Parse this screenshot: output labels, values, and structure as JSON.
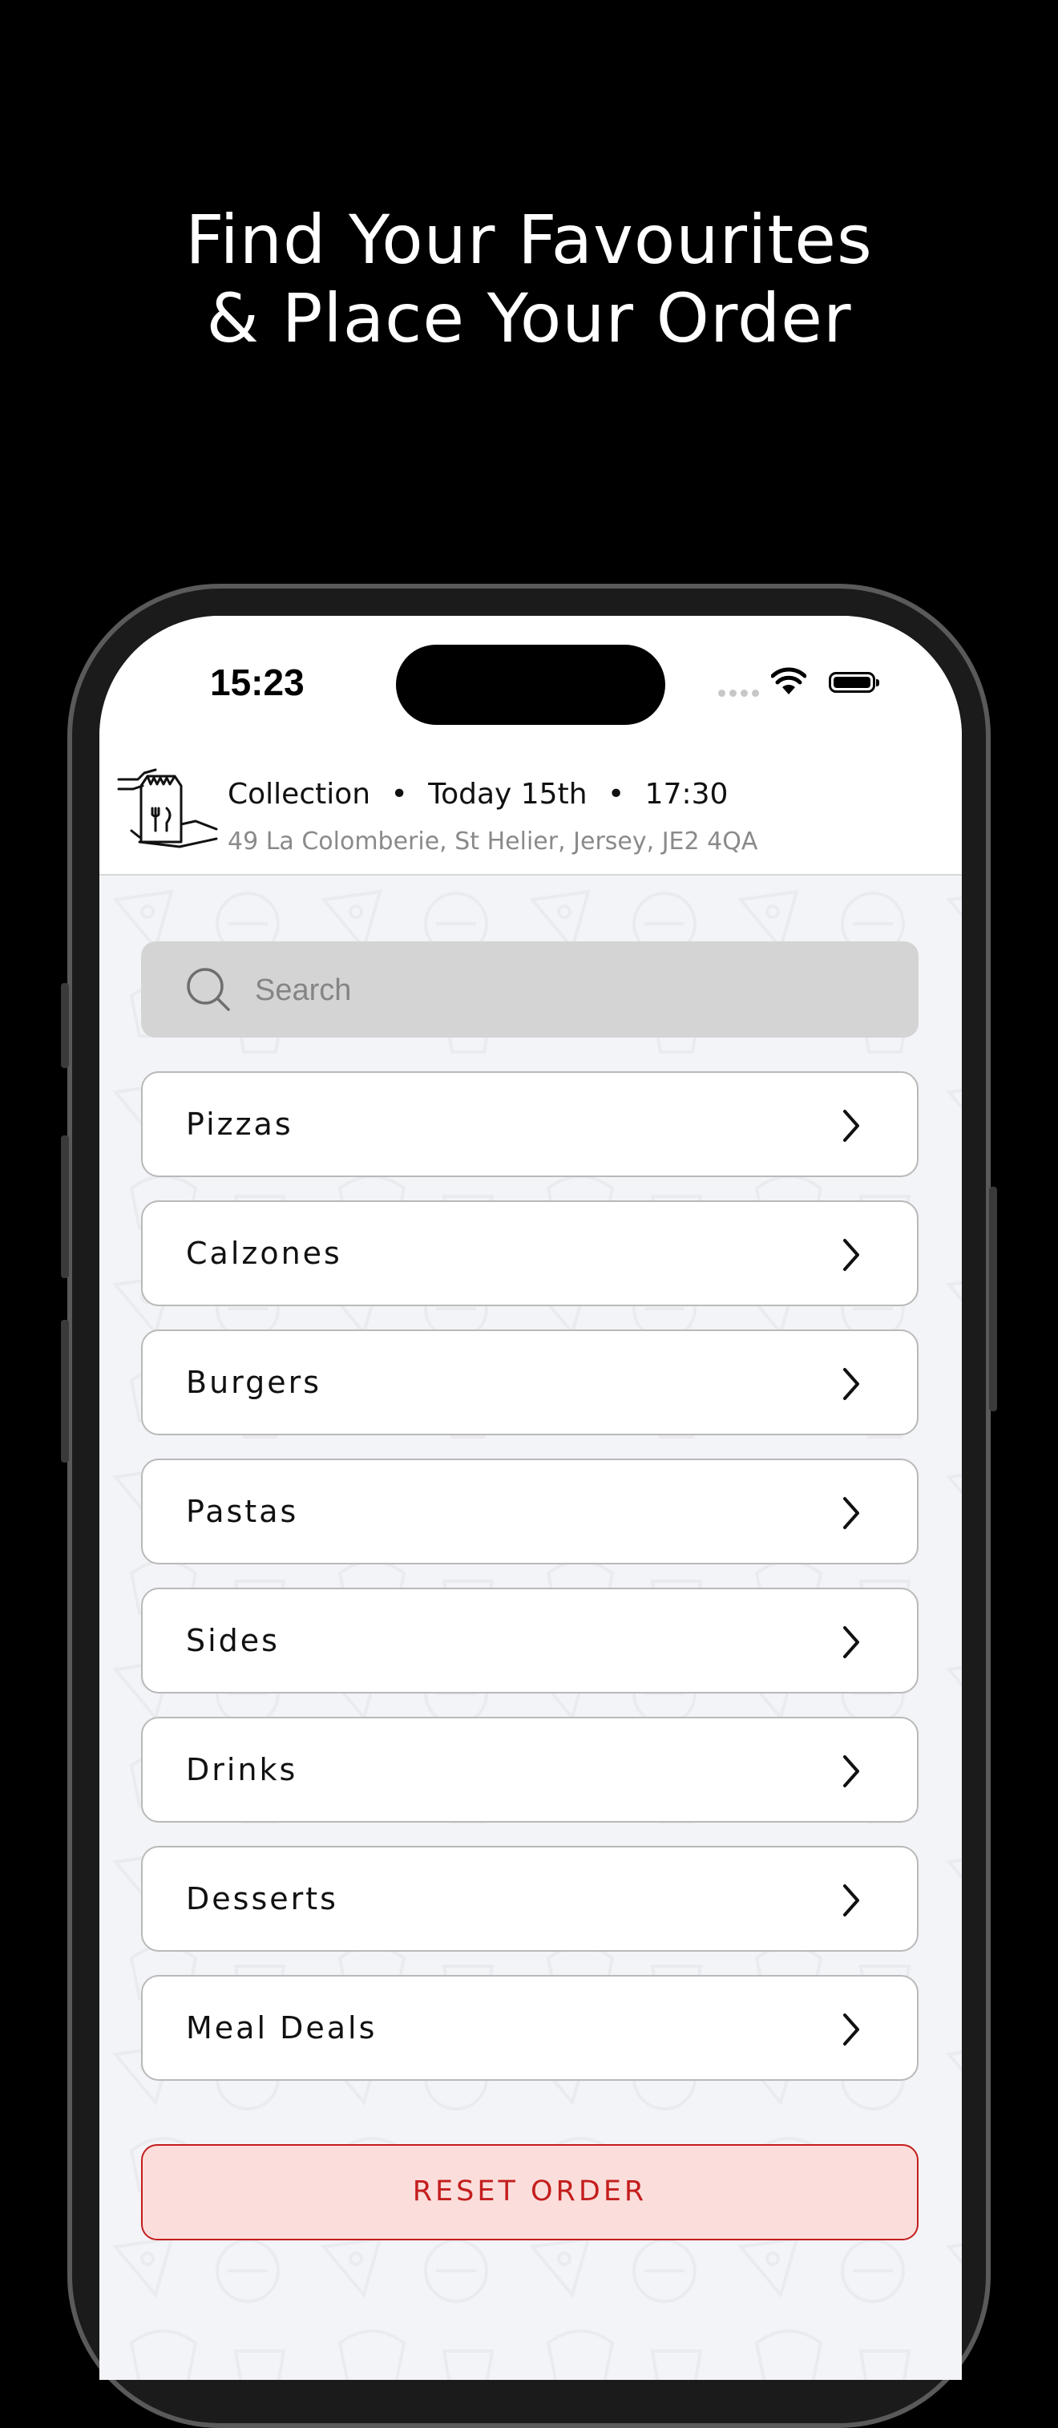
{
  "promo": {
    "line1": "Find Your Favourites",
    "line2": "& Place Your Order"
  },
  "status_bar": {
    "time": "15:23",
    "icons": [
      "signal-icon",
      "wifi-icon",
      "battery-icon"
    ]
  },
  "order_header": {
    "mode": "Collection",
    "day": "Today 15th",
    "time": "17:30",
    "separator": "•",
    "address": "49 La Colomberie, St Helier, Jersey, JE2  4QA",
    "icon": "collection-bag-icon"
  },
  "search": {
    "placeholder": "Search",
    "value": "",
    "icon": "search-icon"
  },
  "categories": [
    {
      "label": "Pizzas"
    },
    {
      "label": "Calzones"
    },
    {
      "label": "Burgers"
    },
    {
      "label": "Pastas"
    },
    {
      "label": "Sides"
    },
    {
      "label": "Drinks"
    },
    {
      "label": "Desserts"
    },
    {
      "label": "Meal Deals"
    }
  ],
  "reset_button": {
    "label": "RESET ORDER"
  },
  "colors": {
    "background": "#000000",
    "screen_bg": "#f3f4f7",
    "search_bg": "#d4d4d4",
    "accent_red": "#c41e1e",
    "reset_bg": "#fbdedb"
  }
}
